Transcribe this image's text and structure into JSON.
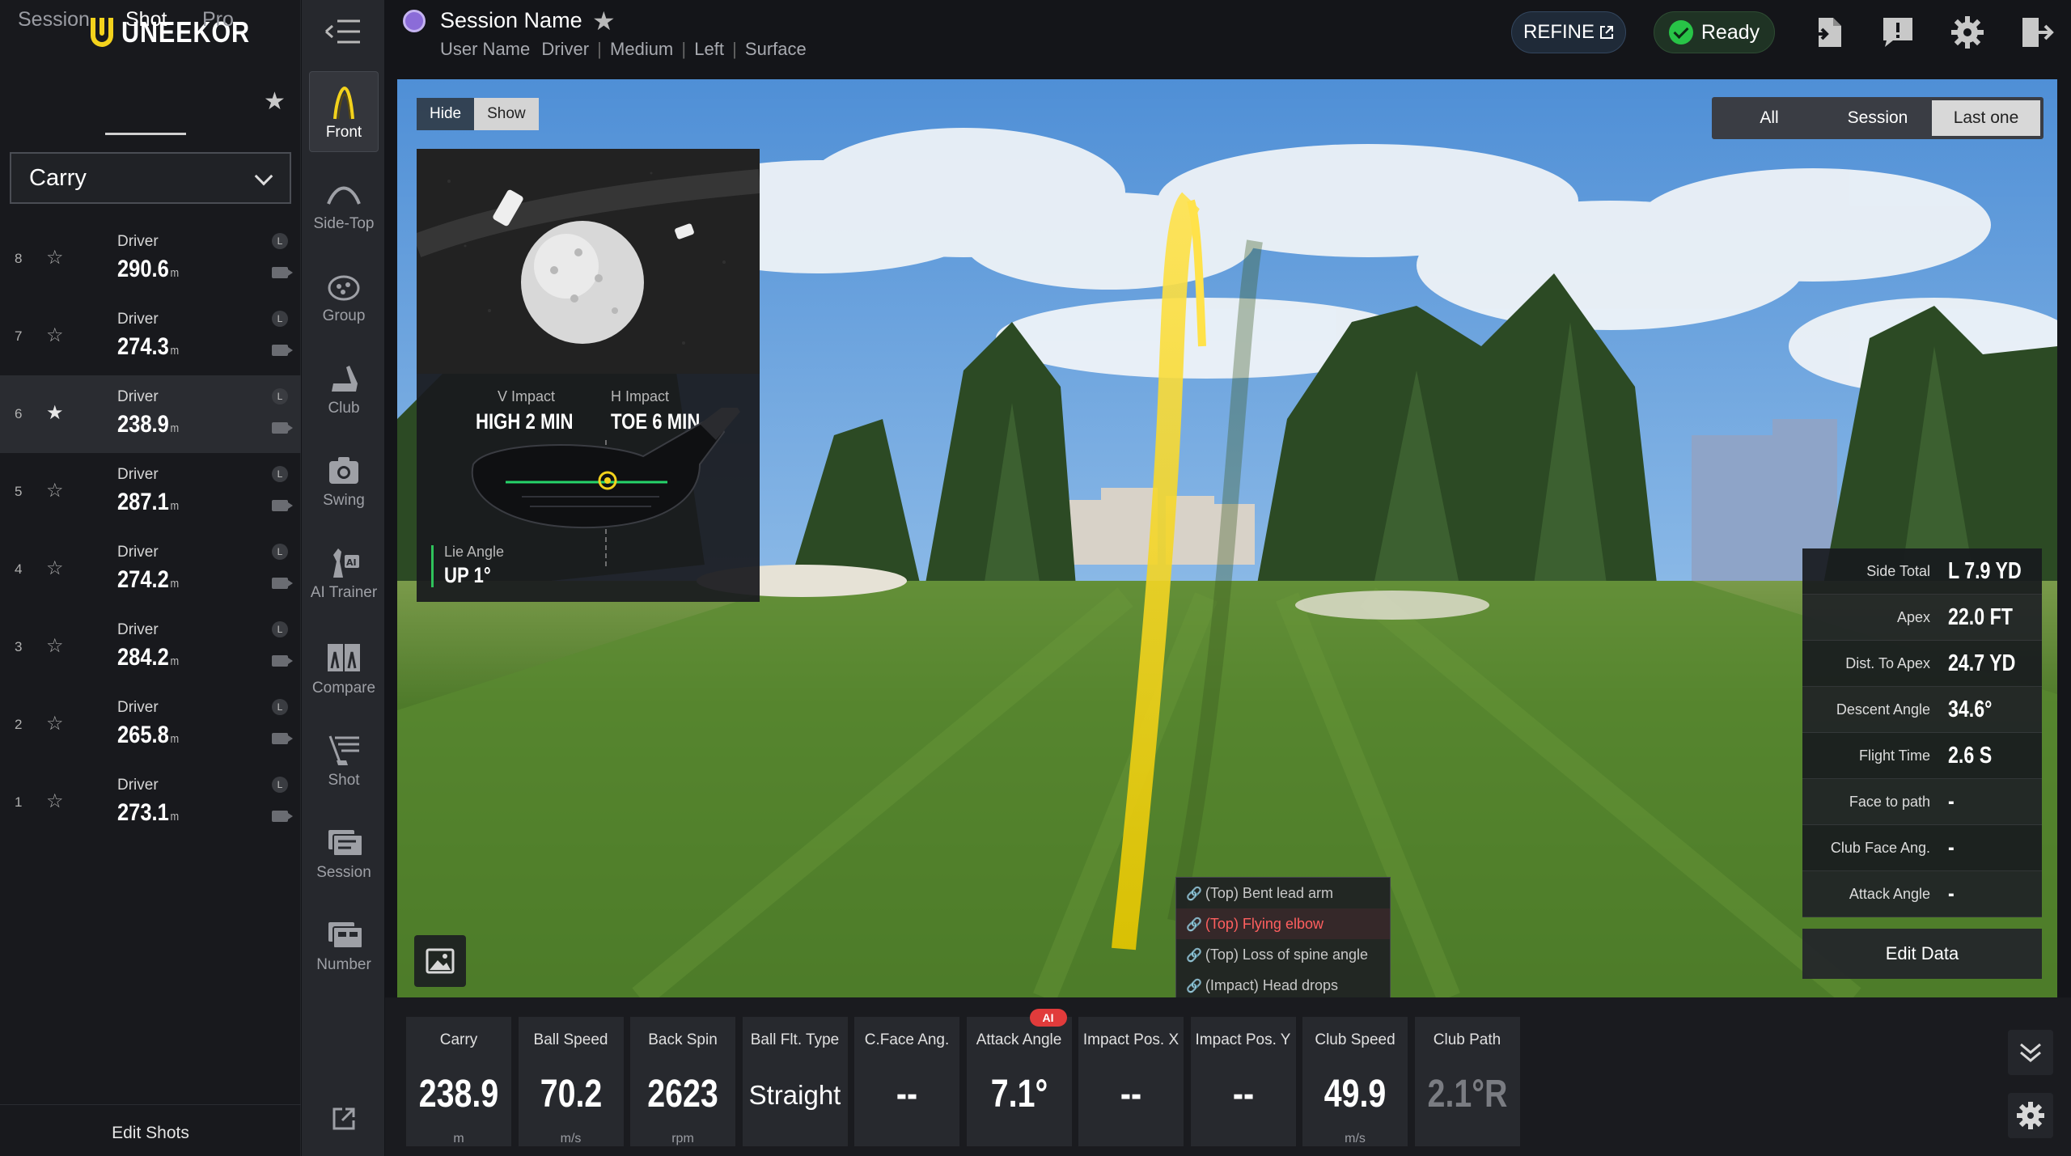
{
  "app": {
    "logo_text": "UNEEKOR"
  },
  "sidebar": {
    "tabs": [
      "Session",
      "Shot",
      "Pro"
    ],
    "active_tab": "Shot",
    "select_value": "Carry",
    "edit_shots_label": "Edit Shots",
    "shots": [
      {
        "num": "8",
        "club": "Driver",
        "dist": "290.6",
        "unit": "m",
        "badge": "L",
        "selected": false
      },
      {
        "num": "7",
        "club": "Driver",
        "dist": "274.3",
        "unit": "m",
        "badge": "L",
        "selected": false
      },
      {
        "num": "6",
        "club": "Driver",
        "dist": "238.9",
        "unit": "m",
        "badge": "L",
        "selected": true
      },
      {
        "num": "5",
        "club": "Driver",
        "dist": "287.1",
        "unit": "m",
        "badge": "L",
        "selected": false
      },
      {
        "num": "4",
        "club": "Driver",
        "dist": "274.2",
        "unit": "m",
        "badge": "L",
        "selected": false
      },
      {
        "num": "3",
        "club": "Driver",
        "dist": "284.2",
        "unit": "m",
        "badge": "L",
        "selected": false
      },
      {
        "num": "2",
        "club": "Driver",
        "dist": "265.8",
        "unit": "m",
        "badge": "L",
        "selected": false
      },
      {
        "num": "1",
        "club": "Driver",
        "dist": "273.1",
        "unit": "m",
        "badge": "L",
        "selected": false
      }
    ]
  },
  "toolbar": {
    "items": [
      {
        "label": "Front",
        "active": true
      },
      {
        "label": "Side-Top",
        "active": false
      },
      {
        "label": "Group",
        "active": false
      },
      {
        "label": "Club",
        "active": false
      },
      {
        "label": "Swing",
        "active": false
      },
      {
        "label": "AI Trainer",
        "active": false
      },
      {
        "label": "Compare",
        "active": false
      },
      {
        "label": "Shot",
        "active": false
      },
      {
        "label": "Session",
        "active": false
      },
      {
        "label": "Number",
        "active": false
      }
    ]
  },
  "header": {
    "session_name": "Session Name",
    "meta": [
      "User Name",
      "Driver",
      "Medium",
      "Left",
      "Surface"
    ],
    "refine_label": "REFINE",
    "ready_label": "Ready"
  },
  "view": {
    "hide_label": "Hide",
    "show_label": "Show",
    "toggle": [
      "All",
      "Session",
      "Last one"
    ],
    "toggle_active": "Last one"
  },
  "impact": {
    "v_label": "V Impact",
    "v_value": "HIGH 2 MIN",
    "h_label": "H Impact",
    "h_value": "TOE 6 MIN",
    "lie_label": "Lie Angle",
    "lie_value": "UP 1°"
  },
  "stats": [
    {
      "label": "Side Total",
      "value": "L 7.9 YD"
    },
    {
      "label": "Apex",
      "value": "22.0 FT"
    },
    {
      "label": "Dist. To Apex",
      "value": "24.7 YD"
    },
    {
      "label": "Descent Angle",
      "value": "34.6°"
    },
    {
      "label": "Flight Time",
      "value": "2.6 S"
    },
    {
      "label": "Face to path",
      "value": "-"
    },
    {
      "label": "Club Face Ang.",
      "value": "-"
    },
    {
      "label": "Attack Angle",
      "value": "-"
    }
  ],
  "edit_data_label": "Edit Data",
  "ai_feedback": [
    {
      "text": "(Top) Bent lead arm",
      "active": false
    },
    {
      "text": "(Top) Flying elbow",
      "active": true
    },
    {
      "text": "(Top) Loss of spine angle",
      "active": false
    },
    {
      "text": "(Impact) Head drops",
      "active": false
    }
  ],
  "metrics": [
    {
      "label": "Carry",
      "value": "238.9",
      "unit": "m",
      "style": "cond"
    },
    {
      "label": "Ball Speed",
      "value": "70.2",
      "unit": "m/s",
      "style": "cond"
    },
    {
      "label": "Back Spin",
      "value": "2623",
      "unit": "rpm",
      "style": "cond"
    },
    {
      "label": "Ball Flt. Type",
      "value": "Straight",
      "unit": "",
      "style": "small"
    },
    {
      "label": "C.Face Ang.",
      "value": "--",
      "unit": "",
      "style": "cond"
    },
    {
      "label": "Attack Angle",
      "value": "7.1°",
      "unit": "",
      "style": "cond",
      "badge": "AI"
    },
    {
      "label": "Impact Pos. X",
      "value": "--",
      "unit": "",
      "style": "cond"
    },
    {
      "label": "Impact Pos. Y",
      "value": "--",
      "unit": "",
      "style": "cond"
    },
    {
      "label": "Club Speed",
      "value": "49.9",
      "unit": "m/s",
      "style": "cond"
    },
    {
      "label": "Club Path",
      "value": "2.1°R",
      "unit": "",
      "style": "dim"
    }
  ],
  "colors": {
    "brand_yellow": "#f3d21c",
    "ready_green": "#28c447",
    "alert_red": "#ff5f5f",
    "session_purple": "#8b6cd8"
  }
}
